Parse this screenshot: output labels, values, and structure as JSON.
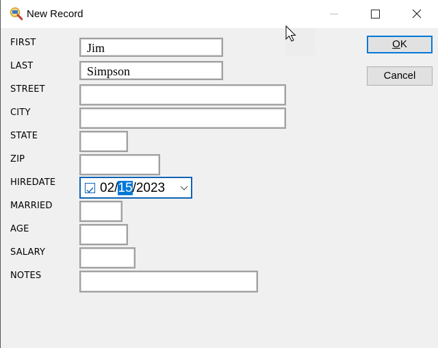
{
  "window": {
    "title": "New Record",
    "icon": "database-search-icon",
    "controls": {
      "minimize": "minimize-icon",
      "maximize": "maximize-icon",
      "close": "close-icon"
    }
  },
  "form": {
    "fields": [
      {
        "label": "FIRST",
        "value": "Jim"
      },
      {
        "label": "LAST",
        "value": "Simpson"
      },
      {
        "label": "STREET",
        "value": ""
      },
      {
        "label": "CITY",
        "value": ""
      },
      {
        "label": "STATE",
        "value": ""
      },
      {
        "label": "ZIP",
        "value": ""
      },
      {
        "label": "HIREDATE",
        "value": "02/15/2023"
      },
      {
        "label": "MARRIED",
        "value": ""
      },
      {
        "label": "AGE",
        "value": ""
      },
      {
        "label": "SALARY",
        "value": ""
      },
      {
        "label": "NOTES",
        "value": ""
      }
    ],
    "hiredate": {
      "checked": true,
      "month": "02",
      "sep1": "/",
      "day": "15",
      "sep2": "/",
      "year": "2023",
      "selected_part": "day"
    }
  },
  "buttons": {
    "ok_mnemonic": "O",
    "ok_rest": "K",
    "cancel": "Cancel"
  }
}
